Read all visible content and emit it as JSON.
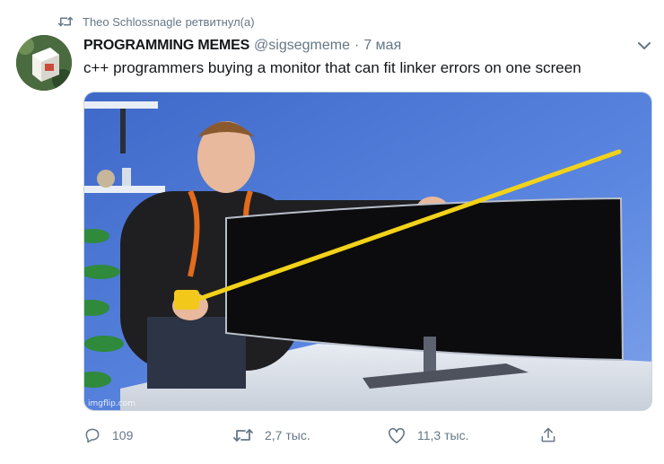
{
  "retweet_context": {
    "user": "Theo Schlossnagle",
    "action": "ретвитнул(а)",
    "icon": "retweet-icon"
  },
  "tweet": {
    "display_name": "PROGRAMMING MEMES",
    "handle": "@sigsegmeme",
    "separator": "·",
    "date": "7 мая",
    "text": "c++ programmers buying a monitor that can fit linker errors on one screen",
    "media_watermark": "imgflip.com"
  },
  "actions": {
    "reply_count": "109",
    "retweet_count": "2,7 тыс.",
    "like_count": "11,3 тыс.",
    "icons": [
      "reply-icon",
      "retweet-icon",
      "like-icon",
      "share-icon"
    ]
  },
  "colors": {
    "text_primary": "#14171a",
    "text_secondary": "#657786",
    "border": "#ccd6dd"
  }
}
